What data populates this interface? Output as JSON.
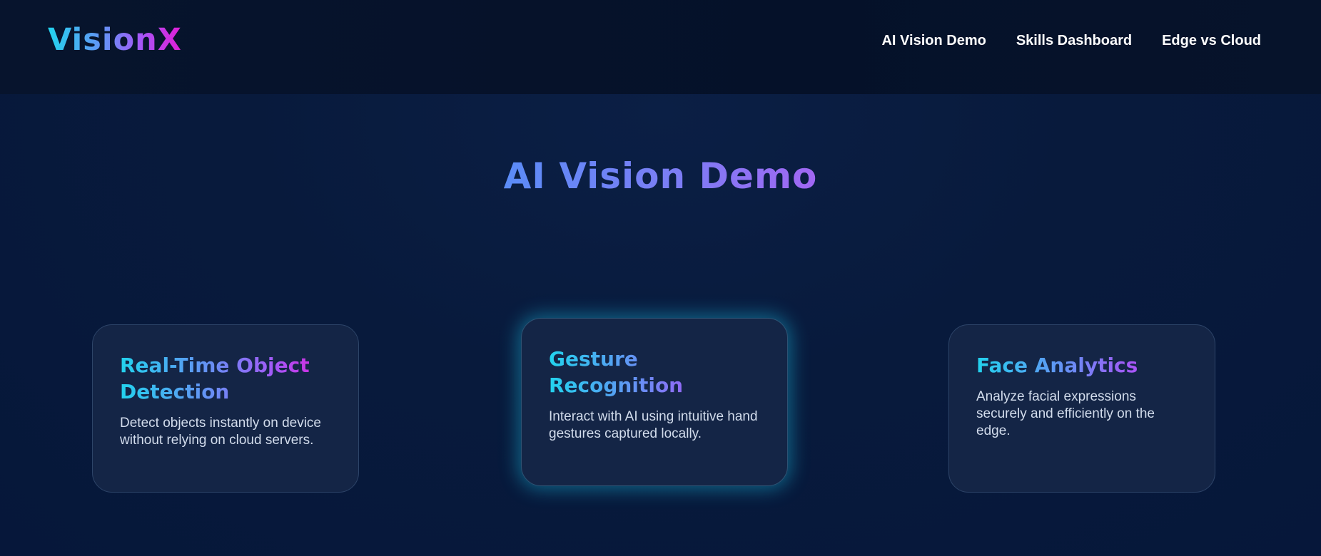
{
  "header": {
    "logo": "VisionX",
    "nav": [
      "AI Vision Demo",
      "Skills Dashboard",
      "Edge vs Cloud"
    ]
  },
  "hero": {
    "title": "AI Vision Demo"
  },
  "cards": [
    {
      "title": "Real-Time Object Detection",
      "text": "Detect objects instantly on device without relying on cloud servers."
    },
    {
      "title": "Gesture Recognition",
      "text": "Interact with AI using intuitive hand gestures captured locally."
    },
    {
      "title": "Face Analytics",
      "text": "Analyze facial expressions securely and efficiently on the edge."
    }
  ],
  "colors": {
    "background": "#071a3a",
    "card": "#142546",
    "accent_cyan": "#22d3ee",
    "accent_purple": "#a855f7",
    "accent_magenta": "#e11dd6",
    "glow": "#1ac4e6"
  }
}
